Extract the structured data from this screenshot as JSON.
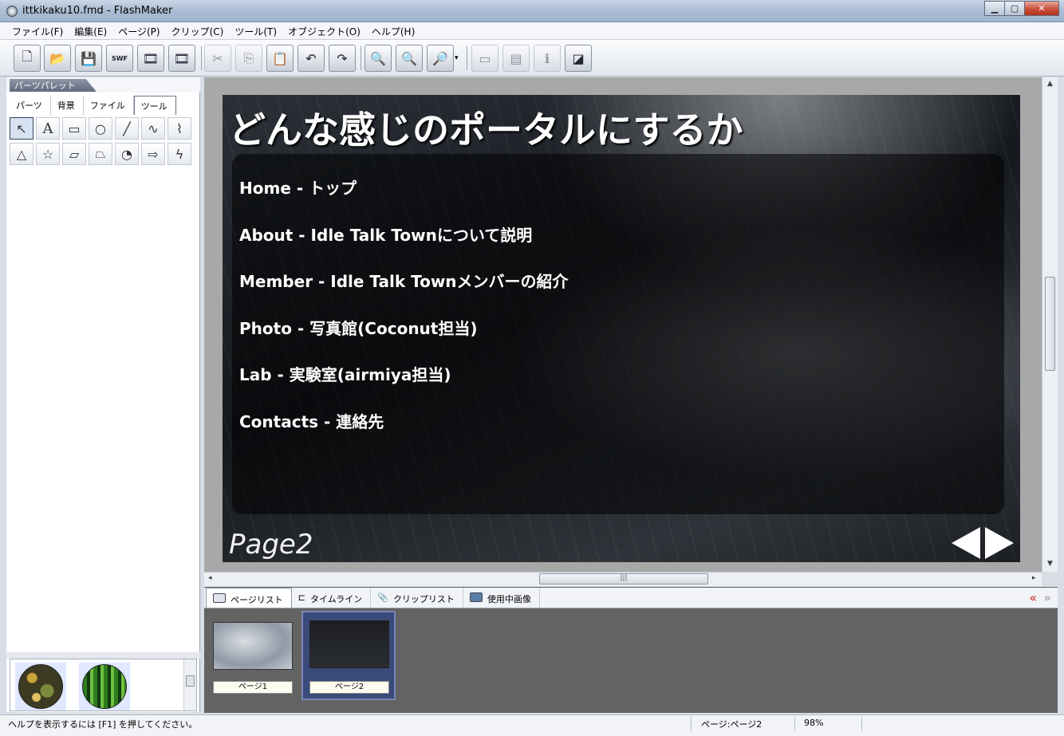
{
  "window": {
    "title": "ittkikaku10.fmd - FlashMaker"
  },
  "menu": [
    "ファイル(F)",
    "編集(E)",
    "ページ(P)",
    "クリップ(C)",
    "ツール(T)",
    "オブジェクト(O)",
    "ヘルプ(H)"
  ],
  "toolbar": {
    "swf_label": "SWF"
  },
  "palette": {
    "title": "パーツパレット",
    "tabs": [
      "パーツ",
      "背景",
      "ファイル",
      "ツール"
    ],
    "active_tab": "ツール"
  },
  "slide": {
    "title": "どんな感じのポータルにするか",
    "items": [
      "Home -  トップ",
      "About - Idle Talk Townについて説明",
      "Member - Idle Talk Townメンバーの紹介",
      "Photo - 写真館(Coconut担当)",
      "Lab - 実験室(airmiya担当)",
      "Contacts - 連絡先"
    ],
    "page_label": "Page2"
  },
  "bottom_tabs": [
    "ページリスト",
    "タイムライン",
    "クリップリスト",
    "使用中画像"
  ],
  "pages": [
    "ページ1",
    "ページ2"
  ],
  "status": {
    "help": "ヘルプを表示するには [F1] を押してください。",
    "page": "ページ:ページ2",
    "zoom": "98%"
  },
  "colors": {
    "accent_red": "#cc2222",
    "selection": "#3a4a7a"
  }
}
